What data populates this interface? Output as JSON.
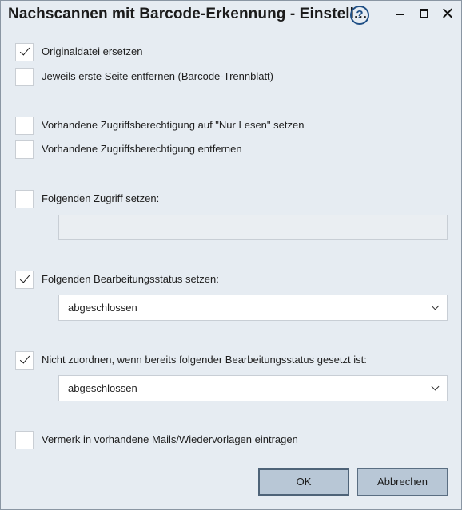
{
  "window": {
    "title": "Nachscannen mit Barcode-Erkennung - Einstell...",
    "help_icon": "help-icon",
    "help_glyph": "?"
  },
  "options": {
    "replace_original": {
      "label": "Originaldatei ersetzen",
      "checked": true
    },
    "remove_first_page": {
      "label": "Jeweils erste Seite entfernen (Barcode-Trennblatt)",
      "checked": false
    },
    "set_readonly": {
      "label": "Vorhandene Zugriffsberechtigung auf \"Nur Lesen\" setzen",
      "checked": false
    },
    "remove_access": {
      "label": "Vorhandene Zugriffsberechtigung entfernen",
      "checked": false
    },
    "set_access": {
      "label": "Folgenden Zugriff setzen:",
      "checked": false,
      "value": ""
    },
    "set_status": {
      "label": "Folgenden Bearbeitungsstatus setzen:",
      "checked": true,
      "selected": "abgeschlossen"
    },
    "skip_if_status": {
      "label": "Nicht zuordnen, wenn bereits folgender Bearbeitungsstatus gesetzt ist:",
      "checked": true,
      "selected": "abgeschlossen"
    },
    "add_note": {
      "label": "Vermerk in vorhandene Mails/Wiedervorlagen eintragen",
      "checked": false
    }
  },
  "buttons": {
    "ok": "OK",
    "cancel": "Abbrechen"
  }
}
